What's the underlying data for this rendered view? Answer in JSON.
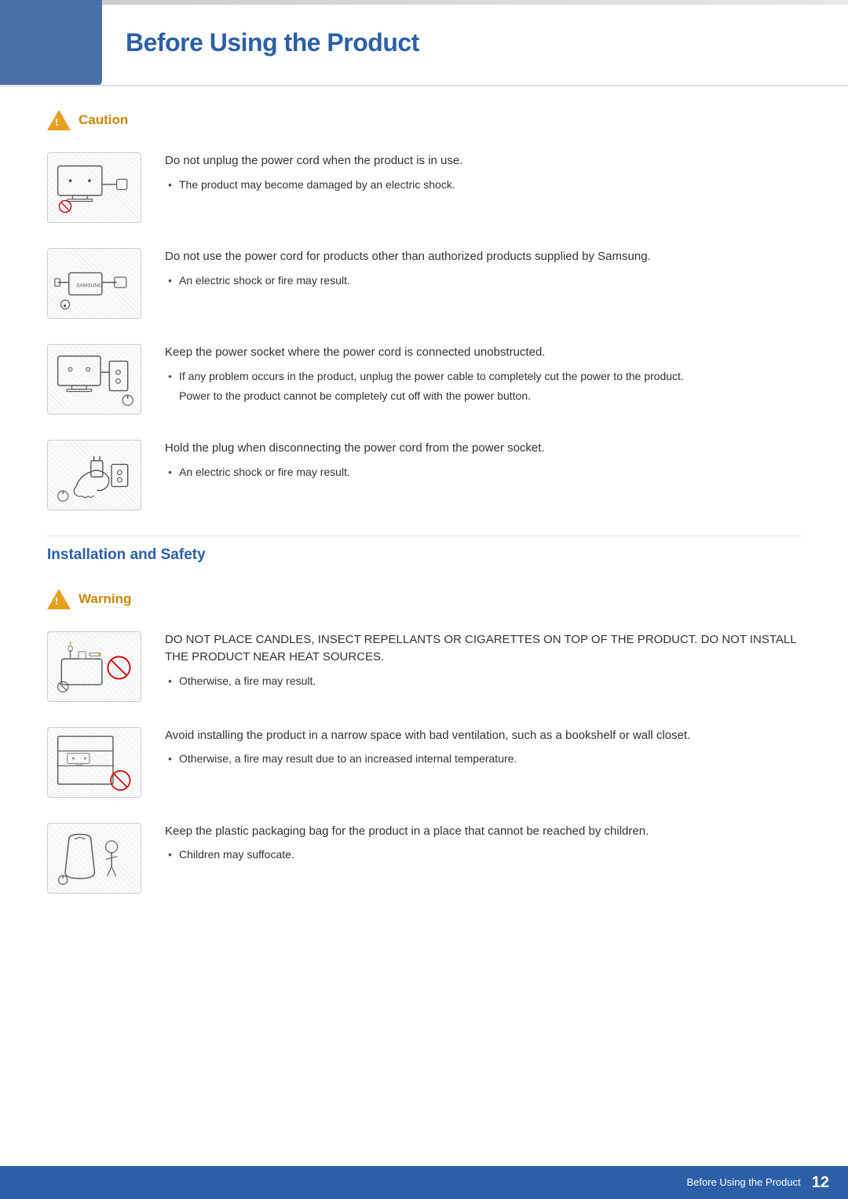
{
  "page": {
    "title": "Before Using the Product",
    "page_number": "12",
    "footer_text": "Before Using the Product"
  },
  "caution_section": {
    "label": "Caution",
    "items": [
      {
        "main": "Do not unplug the power cord when the product is in use.",
        "bullets": [
          "The product may become damaged by an electric shock."
        ],
        "note": null
      },
      {
        "main": "Do not use the power cord for products other than authorized products supplied by Samsung.",
        "bullets": [
          "An electric shock or fire may result."
        ],
        "note": null
      },
      {
        "main": "Keep the power socket where the power cord is connected unobstructed.",
        "bullets": [
          "If any problem occurs in the product, unplug the power cable to completely cut the power to the product."
        ],
        "note": "Power to the product cannot be completely cut off with the power button."
      },
      {
        "main": "Hold the plug when disconnecting the power cord from the power socket.",
        "bullets": [
          "An electric shock or fire may result."
        ],
        "note": null
      }
    ]
  },
  "install_section": {
    "label": "Installation and Safety"
  },
  "warning_section": {
    "label": "Warning",
    "items": [
      {
        "main": "DO NOT PLACE CANDLES, INSECT REPELLANTS OR CIGARETTES ON TOP OF THE PRODUCT. DO NOT INSTALL THE PRODUCT NEAR HEAT SOURCES.",
        "bullets": [
          "Otherwise, a fire may result."
        ],
        "note": null
      },
      {
        "main": "Avoid installing the product in a narrow space with bad ventilation, such as a bookshelf or wall closet.",
        "bullets": [
          "Otherwise, a fire may result due to an increased internal temperature."
        ],
        "note": null
      },
      {
        "main": "Keep the plastic packaging bag for the product in a place that cannot be reached by children.",
        "bullets": [
          "Children may suffocate."
        ],
        "note": null
      }
    ]
  }
}
